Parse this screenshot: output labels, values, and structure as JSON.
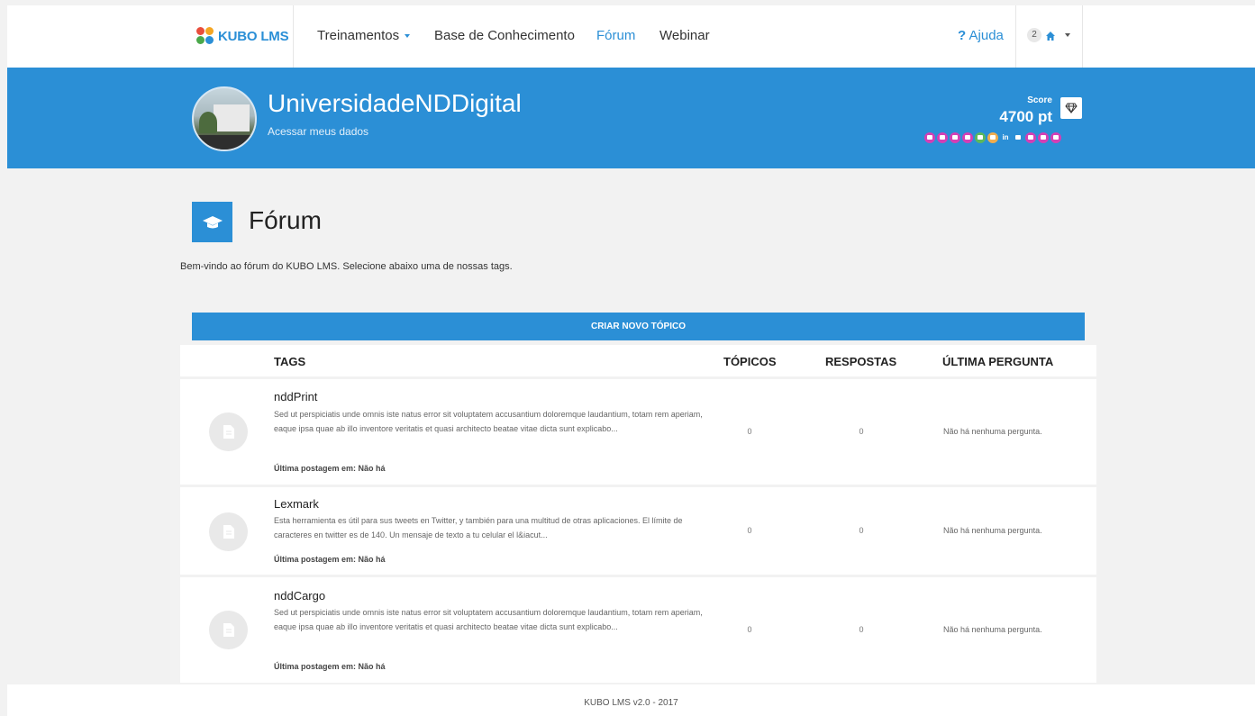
{
  "nav": {
    "logo_text": "KUBO LMS",
    "items": [
      {
        "label": "Treinamentos"
      },
      {
        "label": "Base de Conhecimento"
      },
      {
        "label": "Fórum"
      },
      {
        "label": "Webinar"
      }
    ],
    "help_label": "Ajuda",
    "notification_count": "2"
  },
  "profile": {
    "name": "UniversidadeNDDigital",
    "link": "Acessar meus dados",
    "score_label": "Score",
    "score_value": "4700 pt",
    "badge_colors": [
      "#d43fb5",
      "#d43fb5",
      "#d43fb5",
      "#d43fb5",
      "#5cb85c",
      "#f0ad4e",
      "#2b8fd6",
      "#d43fb5",
      "#d43fb5",
      "#d43fb5"
    ],
    "badge_linkedin_text": "in"
  },
  "page": {
    "title": "Fórum",
    "intro": "Bem-vindo ao fórum do KUBO LMS. Selecione abaixo uma de nossas tags.",
    "create_button": "CRIAR NOVO TÓPICO"
  },
  "table": {
    "headers": {
      "tags": "TAGS",
      "topics": "TÓPICOS",
      "replies": "RESPOSTAS",
      "last_question": "ÚLTIMA PERGUNTA"
    },
    "rows": [
      {
        "title": "nddPrint",
        "description": "Sed ut perspiciatis unde omnis iste natus error sit voluptatem accusantium doloremque laudantium, totam rem aperiam, eaque ipsa quae ab illo inventore veritatis et quasi architecto beatae vitae dicta sunt explicabo...",
        "last_post": "Última postagem em: Não há",
        "topics": "0",
        "replies": "0",
        "last_question": "Não há nenhuma pergunta."
      },
      {
        "title": "Lexmark",
        "description": "Esta herramienta es útil para sus tweets en Twitter, y también para una multitud de otras aplicaciones. El límite de caracteres en twitter es de 140. Un mensaje de texto a tu celular el l&iacut...",
        "last_post": "Última postagem em: Não há",
        "topics": "0",
        "replies": "0",
        "last_question": "Não há nenhuma pergunta."
      },
      {
        "title": "nddCargo",
        "description": "Sed ut perspiciatis unde omnis iste natus error sit voluptatem accusantium doloremque laudantium, totam rem aperiam, eaque ipsa quae ab illo inventore veritatis et quasi architecto beatae vitae dicta sunt explicabo...",
        "last_post": "Última postagem em: Não há",
        "topics": "0",
        "replies": "0",
        "last_question": "Não há nenhuma pergunta."
      }
    ]
  },
  "footer": {
    "text": "KUBO LMS v2.0 - 2017"
  },
  "colors": {
    "accent": "#2b8fd6",
    "background": "#f2f2f2"
  }
}
